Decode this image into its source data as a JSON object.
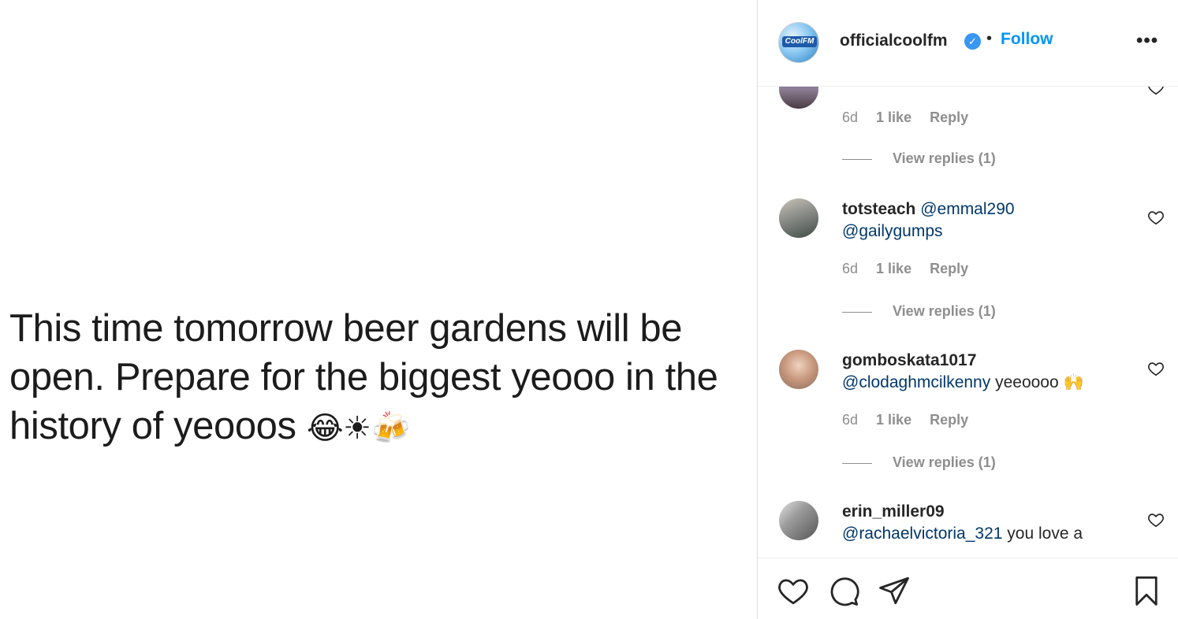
{
  "post": {
    "image_text_line1": "This time tomorrow beer gardens will be",
    "image_text_line2": "open. Prepare for the biggest yeooo in the",
    "image_text_line3": "history of yeooos",
    "image_emojis": "😂☀🍻"
  },
  "header": {
    "username": "officialcoolfm",
    "verified_mark": "✓",
    "separator": "•",
    "follow_label": "Follow",
    "more_label": "•••",
    "avatar_logo": "CoolFM"
  },
  "comments": [
    {
      "meta": {
        "age": "6d",
        "likes": "1 like",
        "reply": "Reply"
      },
      "view_replies": "View replies (1)"
    },
    {
      "username": "totsteach",
      "mention1": "@emmal290",
      "mention2": "@gailygumps",
      "meta": {
        "age": "6d",
        "likes": "1 like",
        "reply": "Reply"
      },
      "view_replies": "View replies (1)"
    },
    {
      "username": "gomboskata1017",
      "mention1": "@clodaghmcilkenny",
      "text": "yeeoooo 🙌",
      "meta": {
        "age": "6d",
        "likes": "1 like",
        "reply": "Reply"
      },
      "view_replies": "View replies (1)"
    },
    {
      "username": "erin_miller09",
      "mention1": "@rachaelvictoria_321",
      "text": "you love a"
    }
  ],
  "colors": {
    "link": "#0095f6",
    "mention": "#00376b",
    "meta": "#8e8e8e",
    "text": "#262626"
  },
  "icons": [
    "heart-icon",
    "comment-icon",
    "share-icon",
    "bookmark-icon"
  ]
}
